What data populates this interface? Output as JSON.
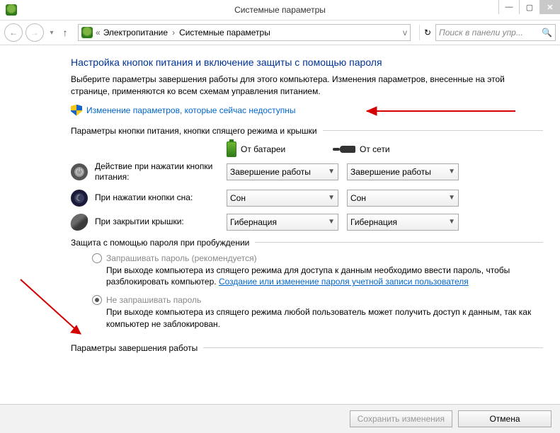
{
  "window": {
    "title": "Системные параметры"
  },
  "breadcrumb": {
    "part1": "Электропитание",
    "part2": "Системные параметры"
  },
  "search": {
    "placeholder": "Поиск в панели упр..."
  },
  "page": {
    "title": "Настройка кнопок питания и включение защиты с помощью пароля",
    "desc": "Выберите параметры завершения работы для этого компьютера. Изменения параметров, внесенные на этой странице, применяются ко всем схемам управления питанием.",
    "uac_link": "Изменение параметров, которые сейчас недоступны"
  },
  "section_buttons": {
    "header": "Параметры кнопки питания, кнопки спящего режима и крышки",
    "col_battery": "От батареи",
    "col_ac": "От сети",
    "rows": [
      {
        "label": "Действие при нажатии кнопки питания:",
        "battery": "Завершение работы",
        "ac": "Завершение работы"
      },
      {
        "label": "При нажатии кнопки сна:",
        "battery": "Сон",
        "ac": "Сон"
      },
      {
        "label": "При закрытии крышки:",
        "battery": "Гибернация",
        "ac": "Гибернация"
      }
    ]
  },
  "section_password": {
    "header": "Защита с помощью пароля при пробуждении",
    "opt1_label": "Запрашивать пароль (рекомендуется)",
    "opt1_desc_a": "При выходе компьютера из спящего режима для доступа к данным необходимо ввести пароль, чтобы разблокировать компьютер. ",
    "opt1_link": "Создание или изменение пароля учетной записи пользователя",
    "opt2_label": "Не запрашивать пароль",
    "opt2_desc": "При выходе компьютера из спящего режима любой пользователь может получить доступ к данным, так как компьютер не заблокирован."
  },
  "section_shutdown": {
    "header": "Параметры завершения работы"
  },
  "footer": {
    "save": "Сохранить изменения",
    "cancel": "Отмена"
  }
}
